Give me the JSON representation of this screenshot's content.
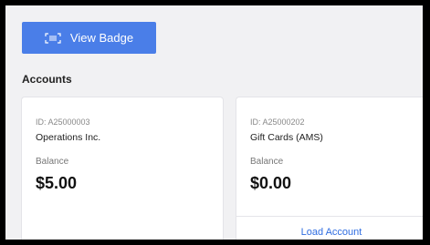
{
  "toolbar": {
    "view_badge_label": "View Badge"
  },
  "accounts": {
    "heading": "Accounts",
    "cards": [
      {
        "id_text": "ID: A25000003",
        "name": "Operations Inc.",
        "balance_label": "Balance",
        "balance": "$5.00"
      },
      {
        "id_text": "ID: A25000202",
        "name": "Gift Cards (AMS)",
        "balance_label": "Balance",
        "balance": "$0.00",
        "action_label": "Load Account"
      }
    ]
  },
  "colors": {
    "accent": "#4a7ee8",
    "link": "#2f6de1",
    "background": "#f1f1f3"
  },
  "icons": {
    "badge": "barcode-scan-icon"
  }
}
